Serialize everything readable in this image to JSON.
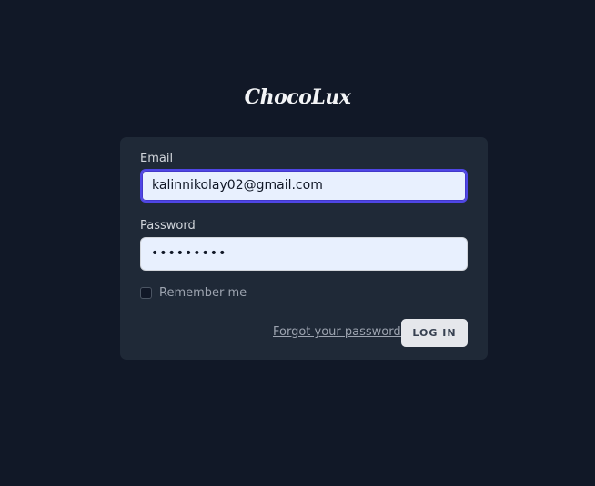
{
  "brand": {
    "logo_text": "ChocoLux"
  },
  "form": {
    "email_label": "Email",
    "email_value": "kalinnikolay02@gmail.com",
    "password_label": "Password",
    "password_masked": "•••••••••",
    "remember_label": "Remember me",
    "remember_checked": false,
    "forgot_link": "Forgot your password?",
    "login_button": "LOG IN"
  },
  "colors": {
    "background": "#111827",
    "card": "#1f2937",
    "input_bg": "#e8f0fe",
    "focus_ring": "#4f46e5",
    "button_bg": "#e5e7eb"
  }
}
